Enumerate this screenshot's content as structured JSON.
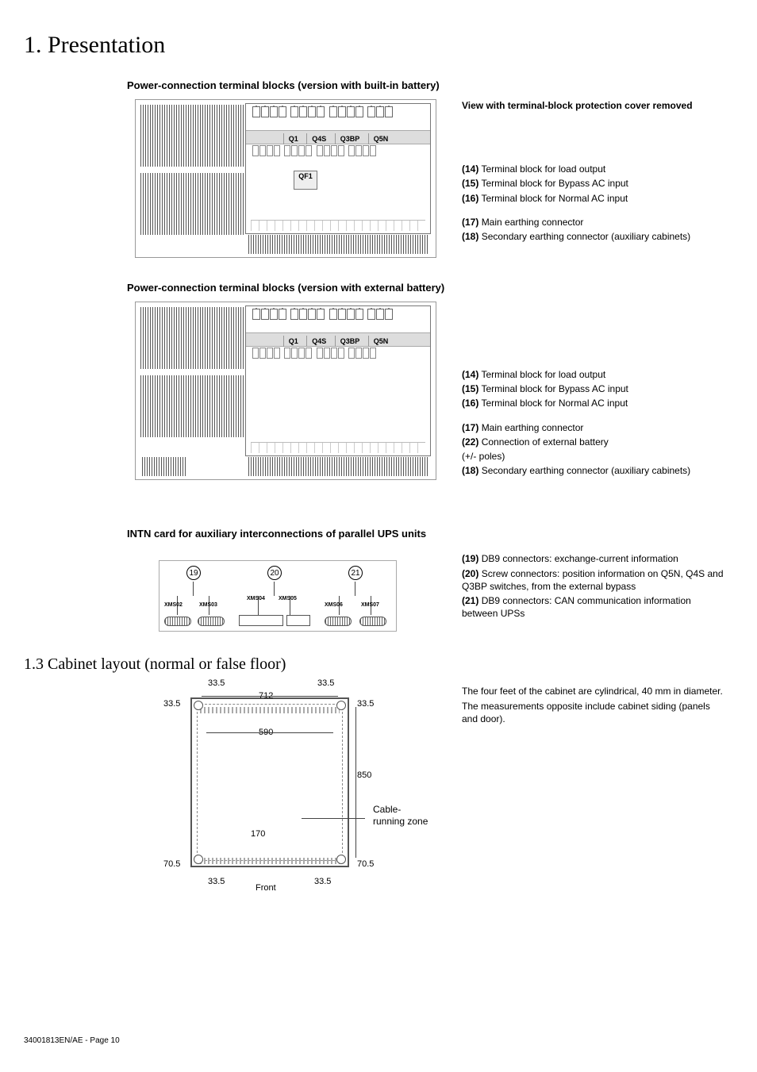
{
  "chapter": "1. Presentation",
  "section_a": {
    "title": "Power-connection terminal blocks (version with built-in battery)",
    "subtitle": "View with terminal-block protection cover removed",
    "breakers": {
      "q1": "Q1",
      "q4s": "Q4S",
      "q3bp": "Q3BP",
      "q5n": "Q5N",
      "qf1": "QF1"
    },
    "items": [
      {
        "num": "(14)",
        "text": "Terminal block for load output"
      },
      {
        "num": "(15)",
        "text": "Terminal block for Bypass AC input"
      },
      {
        "num": "(16)",
        "text": "Terminal block for Normal AC input"
      }
    ],
    "items2": [
      {
        "num": "(17)",
        "text": "Main earthing connector"
      },
      {
        "num": "(18)",
        "text": "Secondary earthing connector (auxiliary cabinets)"
      }
    ]
  },
  "section_b": {
    "title": "Power-connection terminal blocks (version with external battery)",
    "breakers": {
      "q1": "Q1",
      "q4s": "Q4S",
      "q3bp": "Q3BP",
      "q5n": "Q5N"
    },
    "items": [
      {
        "num": "(14)",
        "text": "Terminal block for load output"
      },
      {
        "num": "(15)",
        "text": "Terminal block for Bypass AC input"
      },
      {
        "num": "(16)",
        "text": "Terminal block for Normal AC input"
      }
    ],
    "items2": [
      {
        "num": "(17)",
        "text": "Main earthing connector"
      },
      {
        "num": "(22)",
        "text": "Connection of external battery"
      }
    ],
    "poles": "(+/- poles)",
    "items3": [
      {
        "num": "(18)",
        "text": "Secondary earthing connector (auxiliary cabinets)"
      }
    ]
  },
  "section_c": {
    "title": "INTN card for auxiliary interconnections of parallel UPS units",
    "circled": {
      "c19": "19",
      "c20": "20",
      "c21": "21"
    },
    "xms": {
      "x02": "XMS02",
      "x03": "XMS03",
      "x04": "XMS04",
      "x05": "XMS05",
      "x06": "XMS06",
      "x07": "XMS07"
    },
    "items": [
      {
        "num": "(19)",
        "text": "DB9 connectors: exchange-current information"
      },
      {
        "num": "(20)",
        "text": "Screw connectors: position information on Q5N, Q4S and Q3BP switches, from the external bypass"
      },
      {
        "num": "(21)",
        "text": "DB9 connectors: CAN communication information between UPSs"
      }
    ]
  },
  "subsection": "1.3 Cabinet layout (normal or false floor)",
  "section_d": {
    "dims": {
      "d335": "33.5",
      "d712": "712",
      "d590": "590",
      "d850": "850",
      "d170": "170",
      "d705": "70.5"
    },
    "front": "Front",
    "cable_zone": "Cable-running zone",
    "note1": "The four feet of the cabinet are cylindrical, 40 mm in diameter.",
    "note2": "The measurements opposite include cabinet siding (panels and door)."
  },
  "footer": {
    "ref": "34001813EN/AE",
    "page": " - Page 10"
  }
}
